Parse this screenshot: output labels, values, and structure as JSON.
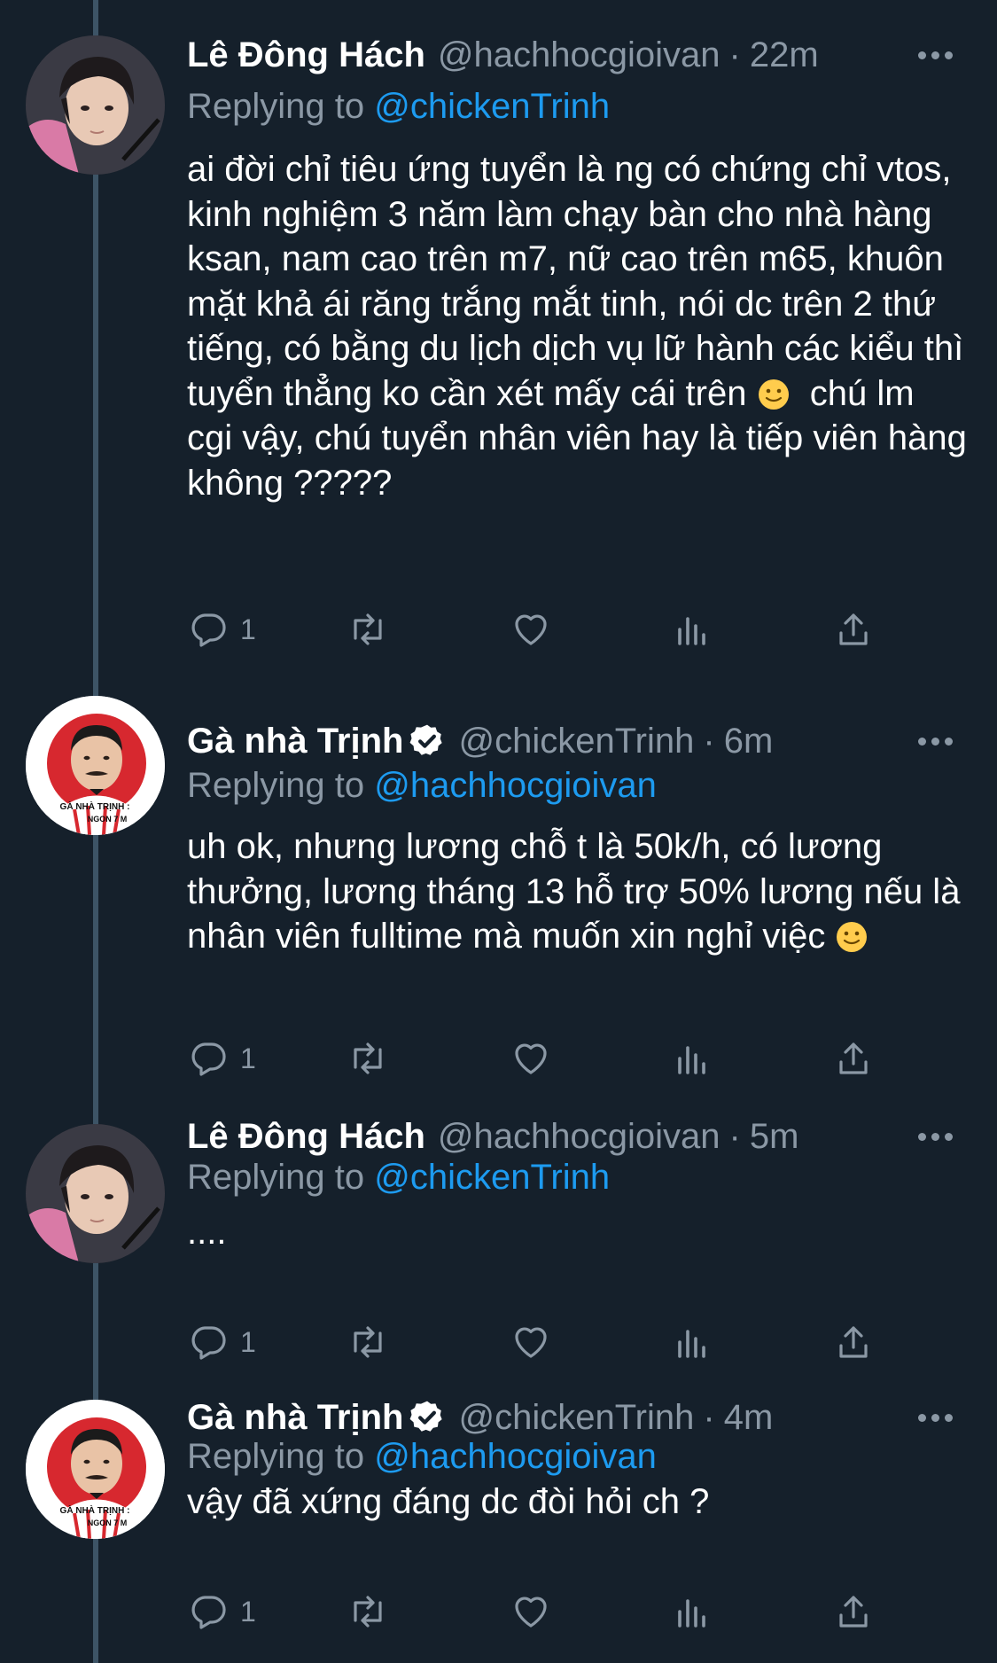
{
  "colors": {
    "background": "#15202b",
    "secondary_text": "#8b98a5",
    "link": "#1d9bf0",
    "thread_line": "#3d5466"
  },
  "tweets": [
    {
      "name": "Lê Đông Hách",
      "handle": "@hachhocgioivan",
      "dot": "·",
      "time": "22m",
      "verified": false,
      "replying_label": "Replying to ",
      "replying_to": "@chickenTrinh",
      "text_before_emoji": "ai đời chỉ tiêu ứng tuyển là ng có chứng chỉ vtos, kinh nghiệm 3 năm làm chạy bàn cho nhà hàng ksan, nam cao trên m7, nữ cao trên m65, khuôn mặt khả ái răng trắng mắt tinh, nói dc trên 2 thứ tiếng, có bằng du lịch dịch vụ lữ hành các kiểu thì tuyển thẳng ko cần xét mấy cái trên ",
      "emoji": "slightly-smiling-face",
      "text_after_emoji": "  chú lm cgi vậy, chú tuyển nhân viên hay là tiếp viên hàng không ?????",
      "reply_count": "1"
    },
    {
      "name": "Gà nhà Trịnh",
      "handle": "@chickenTrinh",
      "dot": "·",
      "time": "6m",
      "verified": true,
      "replying_label": "Replying to ",
      "replying_to": "@hachhocgioivan",
      "text_before_emoji": "uh ok, nhưng lương chỗ t là 50k/h, có lương thưởng, lương tháng 13 hỗ trợ 50% lương nếu là nhân viên fulltime mà muốn xin nghỉ việc ",
      "emoji": "slightly-smiling-face",
      "text_after_emoji": "",
      "reply_count": "1",
      "avatar_caption": "GÀ NHÀ TRỊNH : NGON 7 M"
    },
    {
      "name": "Lê Đông Hách",
      "handle": "@hachhocgioivan",
      "dot": "·",
      "time": "5m",
      "verified": false,
      "replying_label": "Replying to ",
      "replying_to": "@chickenTrinh",
      "text_before_emoji": "....",
      "text_after_emoji": "",
      "reply_count": "1"
    },
    {
      "name": "Gà nhà Trịnh",
      "handle": "@chickenTrinh",
      "dot": "·",
      "time": "4m",
      "verified": true,
      "replying_label": "Replying to ",
      "replying_to": "@hachhocgioivan",
      "text_before_emoji": "vậy đã xứng đáng dc đòi hỏi ch ?",
      "text_after_emoji": "",
      "reply_count": "1",
      "avatar_caption": "GÀ NHÀ TRỊNH : NGON 7 M"
    }
  ],
  "icons": {
    "reply": "reply-icon",
    "retweet": "retweet-icon",
    "like": "like-icon",
    "analytics": "analytics-icon",
    "share": "share-icon",
    "more": "more-icon"
  }
}
